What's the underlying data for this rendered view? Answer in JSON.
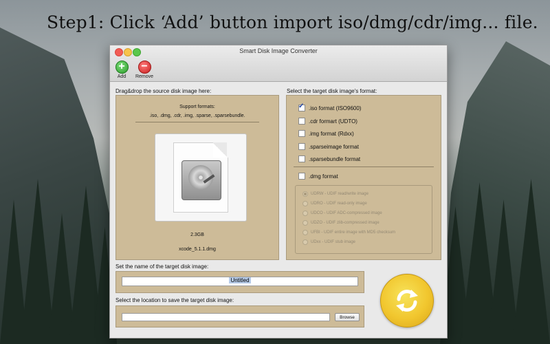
{
  "headline": "Step1: Click ‘Add’ button import iso/dmg/cdr/img... file.",
  "window": {
    "title": "Smart Disk Image Converter"
  },
  "toolbar": {
    "add_label": "Add",
    "remove_label": "Remove"
  },
  "source": {
    "heading": "Drag&drop the source disk image here:",
    "support_title": "Support formats:",
    "support_list": ".iso, .dmg, .cdr, .img, .sparse, .sparsebundle.",
    "file_size": "2.3GB",
    "file_name": "xcode_5.1.1.dmg"
  },
  "target": {
    "heading": "Select the target disk image's format:",
    "formats": [
      {
        "label": ".iso format (ISO9600)",
        "checked": true
      },
      {
        "label": ".cdr formart (UDTO)",
        "checked": false
      },
      {
        "label": ".img format (Rdxx)",
        "checked": false
      },
      {
        "label": ".sparseimage format",
        "checked": false
      },
      {
        "label": ".sparsebundle format",
        "checked": false
      }
    ],
    "dmg_label": ".dmg format",
    "dmg_options": [
      "UDRW - UDIF read/write image",
      "UDRO - UDIF read-only image",
      "UDCO - UDIF ADC-compressed image",
      "UDZO - UDIF zlib-compressed image",
      "UFBI - UDIF entire image with MD5 checksum",
      "UDxx - UDIF stub image"
    ]
  },
  "name": {
    "heading": "Set the name of the target disk image:",
    "value": "Untitled"
  },
  "location": {
    "heading": "Select the location to save the target disk image:",
    "value": "",
    "browse_label": "Browse"
  },
  "colors": {
    "panel": "#cdbb98",
    "convert": "#f1c62e",
    "add": "#2a9a2a",
    "remove": "#c81f1f"
  }
}
